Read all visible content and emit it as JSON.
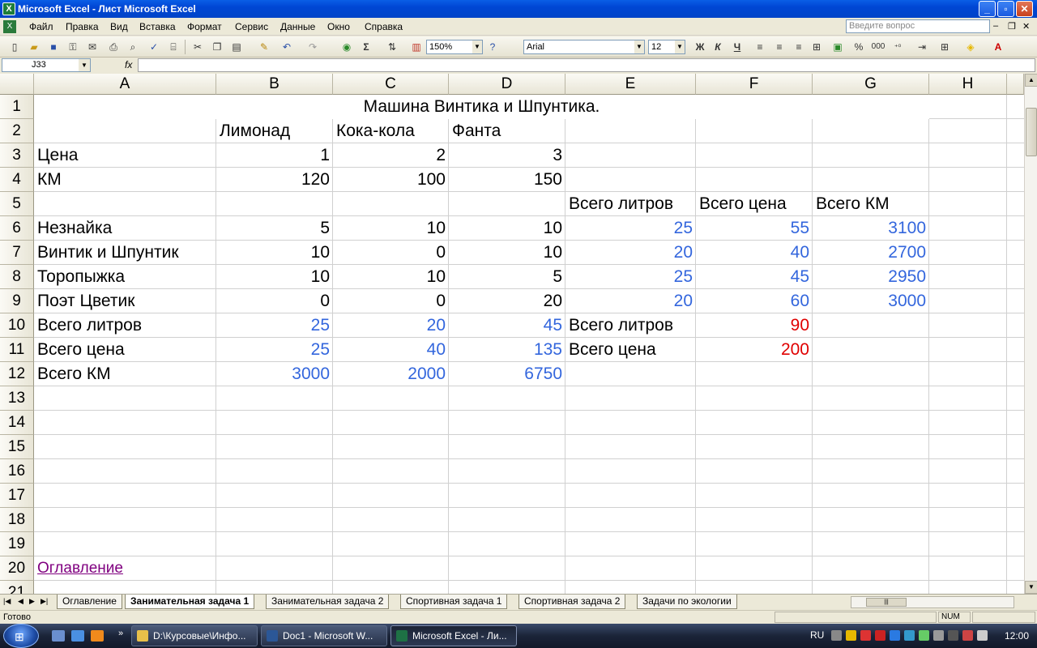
{
  "window": {
    "title": "Microsoft Excel - Лист Microsoft Excel"
  },
  "menu": {
    "items": [
      "Файл",
      "Правка",
      "Вид",
      "Вставка",
      "Формат",
      "Сервис",
      "Данные",
      "Окно",
      "Справка"
    ],
    "ask_placeholder": "Введите вопрос"
  },
  "toolbar": {
    "zoom": "150%",
    "font": "Arial",
    "font_size": "12",
    "bold": "Ж",
    "italic": "К",
    "underline": "Ч",
    "percent": "%",
    "thousands": "000"
  },
  "formula_bar": {
    "cell_ref": "J33",
    "fx": "fx",
    "value": ""
  },
  "columns": [
    "A",
    "B",
    "C",
    "D",
    "E",
    "F",
    "G",
    "H"
  ],
  "rows": [
    "1",
    "2",
    "3",
    "4",
    "5",
    "6",
    "7",
    "8",
    "9",
    "10",
    "11",
    "12",
    "13",
    "14",
    "15",
    "16",
    "17",
    "18",
    "19",
    "20",
    "21"
  ],
  "cells": {
    "title": "Машина Винтика и Шпунтика.",
    "r2": {
      "b": "Лимонад",
      "c": "Кока-кола",
      "d": "Фанта"
    },
    "r3": {
      "a": "Цена",
      "b": "1",
      "c": "2",
      "d": "3"
    },
    "r4": {
      "a": "КМ",
      "b": "120",
      "c": "100",
      "d": "150"
    },
    "r5": {
      "e": "Всего литров",
      "f": "Всего цена",
      "g": "Всего КМ"
    },
    "r6": {
      "a": "Незнайка",
      "b": "5",
      "c": "10",
      "d": "10",
      "e": "25",
      "f": "55",
      "g": "3100"
    },
    "r7": {
      "a": "Винтик и Шпунтик",
      "b": "10",
      "c": "0",
      "d": "10",
      "e": "20",
      "f": "40",
      "g": "2700"
    },
    "r8": {
      "a": "Торопыжка",
      "b": "10",
      "c": "10",
      "d": "5",
      "e": "25",
      "f": "45",
      "g": "2950"
    },
    "r9": {
      "a": "Поэт Цветик",
      "b": "0",
      "c": "0",
      "d": "20",
      "e": "20",
      "f": "60",
      "g": "3000"
    },
    "r10": {
      "a": "Всего литров",
      "b": "25",
      "c": "20",
      "d": "45",
      "e": "Всего литров",
      "f": "90"
    },
    "r11": {
      "a": "Всего цена",
      "b": "25",
      "c": "40",
      "d": "135",
      "e": "Всего цена",
      "f": "200"
    },
    "r12": {
      "a": "Всего КМ",
      "b": "3000",
      "c": "2000",
      "d": "6750"
    },
    "r20": {
      "a": "Оглавление"
    }
  },
  "sheet_tabs": [
    "Оглавление",
    "Занимательная задача 1",
    "Занимательная задача 2",
    "Спортивная задача 1",
    "Спортивная задача 2",
    "Задачи по экологии"
  ],
  "active_tab": "Занимательная задача 1",
  "status": {
    "text": "Готово",
    "num": "NUM"
  },
  "taskbar": {
    "tasks": [
      "D:\\Курсовые\\Инфо...",
      "Doc1 - Microsoft W...",
      "Microsoft Excel - Ли..."
    ],
    "lang": "RU",
    "clock": "12:00"
  },
  "colors": {
    "formula_result": "#3366dd",
    "grand_total": "#e00000",
    "hyperlink": "#800080",
    "titlebar": "#0a5ee6"
  }
}
